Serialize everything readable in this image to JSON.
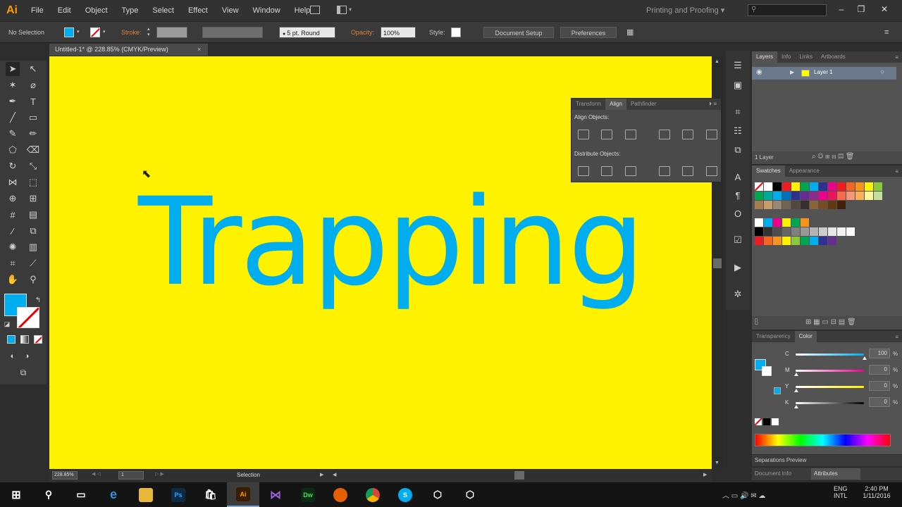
{
  "app": {
    "logo": "Ai"
  },
  "menu": [
    "File",
    "Edit",
    "Object",
    "Type",
    "Select",
    "Effect",
    "View",
    "Window",
    "Help"
  ],
  "workspace": "Printing and Proofing",
  "control": {
    "selection": "No Selection",
    "stroke_label": "Stroke:",
    "brush": "5 pt. Round",
    "opacity_label": "Opacity:",
    "opacity": "100%",
    "style_label": "Style:",
    "doc_setup": "Document Setup",
    "preferences": "Preferences"
  },
  "document": {
    "tab": "Untitled-1* @ 228.85% (CMYK/Preview)",
    "close": "×"
  },
  "artwork": {
    "text": "Trapping",
    "fill": "#00aeef",
    "background": "#fff200"
  },
  "align_panel": {
    "tabs": [
      "Transform",
      "Align",
      "Pathfinder"
    ],
    "active_tab": "Align",
    "align_objects": "Align Objects:",
    "distribute_objects": "Distribute Objects:"
  },
  "layers_panel": {
    "tabs": [
      "Layers",
      "Info",
      "Links",
      "Artboards"
    ],
    "layer_name": "Layer 1",
    "layer_count": "1 Layer"
  },
  "swatches_panel": {
    "tabs": [
      "Swatches",
      "Appearance"
    ]
  },
  "color_panel": {
    "tabs": [
      "Transparency",
      "Color"
    ],
    "channels": [
      {
        "label": "C",
        "value": "100",
        "color": "#00aeef"
      },
      {
        "label": "M",
        "value": "0",
        "color": "#ec008c"
      },
      {
        "label": "Y",
        "value": "0",
        "color": "#fff200"
      },
      {
        "label": "K",
        "value": "0",
        "color": "#000000"
      }
    ],
    "percent": "%"
  },
  "bottom_panels": {
    "separations": "Separations Preview",
    "doc_info": "Document Info",
    "attributes": "Attributes"
  },
  "status": {
    "zoom": "228.85%",
    "artboard": "1",
    "tool": "Selection"
  },
  "taskbar": {
    "lang1": "ENG",
    "lang2": "INTL",
    "time": "2:40 PM",
    "date": "1/11/2016"
  },
  "colors": {
    "accent": "#00aeef",
    "chrome": "#323232",
    "orange": "#ff9a00"
  }
}
